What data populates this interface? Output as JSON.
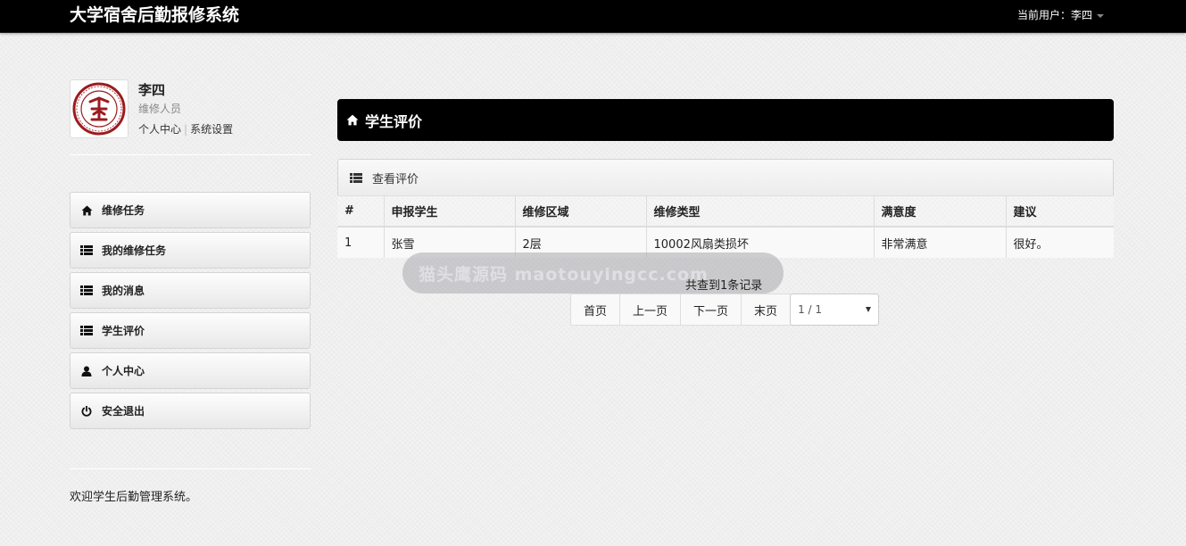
{
  "app": {
    "title": "大学宿舍后勤报修系统",
    "current_user_label": "当前用户：李四"
  },
  "profile": {
    "name": "李四",
    "role": "维修人员",
    "links": [
      "个人中心",
      "系统设置"
    ],
    "separator": "|"
  },
  "sidebar": {
    "items": [
      {
        "label": "维修任务",
        "icon": "home-icon"
      },
      {
        "label": "我的维修任务",
        "icon": "list-icon"
      },
      {
        "label": "我的消息",
        "icon": "list-icon"
      },
      {
        "label": "学生评价",
        "icon": "list-icon"
      },
      {
        "label": "个人中心",
        "icon": "user-icon"
      },
      {
        "label": "安全退出",
        "icon": "power-icon"
      }
    ]
  },
  "footer": {
    "text": "欢迎学生后勤管理系统。"
  },
  "main": {
    "header_title": "学生评价",
    "panel_title": "查看评价",
    "table": {
      "columns": [
        "#",
        "申报学生",
        "维修区域",
        "维修类型",
        "满意度",
        "建议"
      ],
      "rows": [
        [
          "1",
          "张雪",
          "2层",
          "10002风扇类损坏",
          "非常满意",
          "很好。"
        ]
      ]
    },
    "records_text": "共查到1条记录",
    "pagination": {
      "first": "首页",
      "prev": "上一页",
      "next": "下一页",
      "last": "末页",
      "page_select": "1 / 1"
    }
  },
  "watermark": {
    "text": "猫头鹰源码 maotouyingcc.com"
  }
}
